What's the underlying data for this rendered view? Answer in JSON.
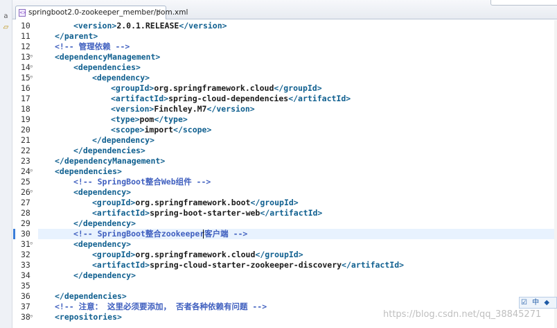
{
  "tab": {
    "title": "springboot2.0-zookeeper_member/pom.xml",
    "close_glyph": "✕"
  },
  "ime": {
    "item1": "☑",
    "item2": "中",
    "item3": "◆"
  },
  "watermark": "https://blog.csdn.net/qq_38845271",
  "icons": {
    "strip_a": "a",
    "strip_b": "▱"
  },
  "lines": [
    {
      "num": "10",
      "fold": "",
      "parts": [
        [
          "t",
          "<version>"
        ],
        [
          "v",
          "2.0.1.RELEASE"
        ],
        [
          "t",
          "</version>"
        ]
      ]
    },
    {
      "num": "11",
      "fold": "",
      "parts": [
        [
          "t",
          "</parent>"
        ]
      ]
    },
    {
      "num": "12",
      "fold": "",
      "parts": [
        [
          "c",
          "<!-- 管理依赖 -->"
        ]
      ]
    },
    {
      "num": "13",
      "fold": "⊖",
      "parts": [
        [
          "t",
          "<dependencyManagement>"
        ]
      ]
    },
    {
      "num": "14",
      "fold": "⊖",
      "parts": [
        [
          "t",
          "<dependencies>"
        ]
      ]
    },
    {
      "num": "15",
      "fold": "⊖",
      "parts": [
        [
          "t",
          "<dependency>"
        ]
      ]
    },
    {
      "num": "16",
      "fold": "",
      "parts": [
        [
          "t",
          "<groupId>"
        ],
        [
          "v",
          "org.springframework.cloud"
        ],
        [
          "t",
          "</groupId>"
        ]
      ]
    },
    {
      "num": "17",
      "fold": "",
      "parts": [
        [
          "t",
          "<artifactId>"
        ],
        [
          "v",
          "spring-cloud-dependencies"
        ],
        [
          "t",
          "</artifactId>"
        ]
      ]
    },
    {
      "num": "18",
      "fold": "",
      "parts": [
        [
          "t",
          "<version>"
        ],
        [
          "v",
          "Finchley.M7"
        ],
        [
          "t",
          "</version>"
        ]
      ]
    },
    {
      "num": "19",
      "fold": "",
      "parts": [
        [
          "t",
          "<type>"
        ],
        [
          "v",
          "pom"
        ],
        [
          "t",
          "</type>"
        ]
      ]
    },
    {
      "num": "20",
      "fold": "",
      "parts": [
        [
          "t",
          "<scope>"
        ],
        [
          "v",
          "import"
        ],
        [
          "t",
          "</scope>"
        ]
      ]
    },
    {
      "num": "21",
      "fold": "",
      "parts": [
        [
          "t",
          "</dependency>"
        ]
      ]
    },
    {
      "num": "22",
      "fold": "",
      "parts": [
        [
          "t",
          "</dependencies>"
        ]
      ]
    },
    {
      "num": "23",
      "fold": "",
      "parts": [
        [
          "t",
          "</dependencyManagement>"
        ]
      ]
    },
    {
      "num": "24",
      "fold": "⊖",
      "parts": [
        [
          "t",
          "<dependencies>"
        ]
      ]
    },
    {
      "num": "25",
      "fold": "",
      "parts": [
        [
          "c",
          "<!-- SpringBoot整合Web组件 -->"
        ]
      ]
    },
    {
      "num": "26",
      "fold": "⊖",
      "parts": [
        [
          "t",
          "<dependency>"
        ]
      ]
    },
    {
      "num": "27",
      "fold": "",
      "parts": [
        [
          "t",
          "<groupId>"
        ],
        [
          "v",
          "org.springframework.boot"
        ],
        [
          "t",
          "</groupId>"
        ]
      ]
    },
    {
      "num": "28",
      "fold": "",
      "parts": [
        [
          "t",
          "<artifactId>"
        ],
        [
          "v",
          "spring-boot-starter-web"
        ],
        [
          "t",
          "</artifactId>"
        ]
      ]
    },
    {
      "num": "29",
      "fold": "",
      "parts": [
        [
          "t",
          "</dependency>"
        ]
      ]
    },
    {
      "num": "30",
      "fold": "",
      "parts": [
        [
          "c",
          "<!-- SpringBoot整合zookeeper客户端 -->"
        ]
      ]
    },
    {
      "num": "31",
      "fold": "⊖",
      "parts": [
        [
          "t",
          "<dependency>"
        ]
      ]
    },
    {
      "num": "32",
      "fold": "",
      "parts": [
        [
          "t",
          "<groupId>"
        ],
        [
          "v",
          "org.springframework.cloud"
        ],
        [
          "t",
          "</groupId>"
        ]
      ]
    },
    {
      "num": "33",
      "fold": "",
      "parts": [
        [
          "t",
          "<artifactId>"
        ],
        [
          "v",
          "spring-cloud-starter-zookeeper-discovery"
        ],
        [
          "t",
          "</artifactId>"
        ]
      ]
    },
    {
      "num": "34",
      "fold": "",
      "parts": [
        [
          "t",
          "</dependency>"
        ]
      ]
    },
    {
      "num": "35",
      "fold": "",
      "parts": []
    },
    {
      "num": "36",
      "fold": "",
      "parts": [
        [
          "t",
          "</dependencies>"
        ]
      ]
    },
    {
      "num": "37",
      "fold": "",
      "parts": [
        [
          "c",
          "<!-- 注意： 这里必须要添加， 否者各种依赖有问题 -->"
        ]
      ]
    },
    {
      "num": "38",
      "fold": "⊖",
      "parts": [
        [
          "t",
          "<repositories>"
        ]
      ]
    }
  ]
}
